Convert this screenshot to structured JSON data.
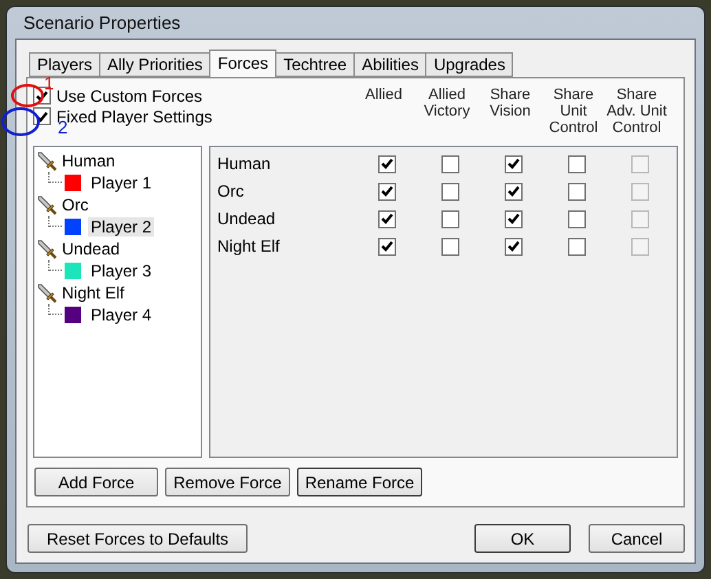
{
  "window": {
    "title": "Scenario Properties"
  },
  "tabs": [
    {
      "label": "Players",
      "selected": false
    },
    {
      "label": "Ally Priorities",
      "selected": false
    },
    {
      "label": "Forces",
      "selected": true
    },
    {
      "label": "Techtree",
      "selected": false
    },
    {
      "label": "Abilities",
      "selected": false
    },
    {
      "label": "Upgrades",
      "selected": false
    }
  ],
  "options": [
    {
      "label": "Use Custom Forces",
      "checked": true
    },
    {
      "label": "Fixed Player Settings",
      "checked": true
    }
  ],
  "annotations": [
    {
      "text": "1",
      "color": "#e01010"
    },
    {
      "text": "2",
      "color": "#1020d0"
    }
  ],
  "forces_tree": [
    {
      "label": "Human",
      "children": [
        {
          "label": "Player 1",
          "color": "#ff0000",
          "selected": false
        }
      ]
    },
    {
      "label": "Orc",
      "children": [
        {
          "label": "Player 2",
          "color": "#0042ff",
          "selected": true
        }
      ]
    },
    {
      "label": "Undead",
      "children": [
        {
          "label": "Player 3",
          "color": "#1ce6b9",
          "selected": false
        }
      ]
    },
    {
      "label": "Night Elf",
      "children": [
        {
          "label": "Player 4",
          "color": "#540081",
          "selected": false
        }
      ]
    }
  ],
  "grid": {
    "columns": [
      "Allied",
      "Allied Victory",
      "Share Vision",
      "Share Unit Control",
      "Share Adv. Unit Control"
    ],
    "rows": [
      {
        "name": "Human",
        "cells": [
          {
            "checked": true,
            "disabled": false
          },
          {
            "checked": false,
            "disabled": false
          },
          {
            "checked": true,
            "disabled": false
          },
          {
            "checked": false,
            "disabled": false
          },
          {
            "checked": false,
            "disabled": true
          }
        ]
      },
      {
        "name": "Orc",
        "cells": [
          {
            "checked": true,
            "disabled": false
          },
          {
            "checked": false,
            "disabled": false
          },
          {
            "checked": true,
            "disabled": false
          },
          {
            "checked": false,
            "disabled": false
          },
          {
            "checked": false,
            "disabled": true
          }
        ]
      },
      {
        "name": "Undead",
        "cells": [
          {
            "checked": true,
            "disabled": false
          },
          {
            "checked": false,
            "disabled": false
          },
          {
            "checked": true,
            "disabled": false
          },
          {
            "checked": false,
            "disabled": false
          },
          {
            "checked": false,
            "disabled": true
          }
        ]
      },
      {
        "name": "Night Elf",
        "cells": [
          {
            "checked": true,
            "disabled": false
          },
          {
            "checked": false,
            "disabled": false
          },
          {
            "checked": true,
            "disabled": false
          },
          {
            "checked": false,
            "disabled": false
          },
          {
            "checked": false,
            "disabled": true
          }
        ]
      }
    ]
  },
  "force_buttons": [
    "Add Force",
    "Remove Force",
    "Rename Force"
  ],
  "footer": {
    "reset": "Reset Forces to Defaults",
    "buttons": [
      "OK",
      "Cancel"
    ]
  }
}
